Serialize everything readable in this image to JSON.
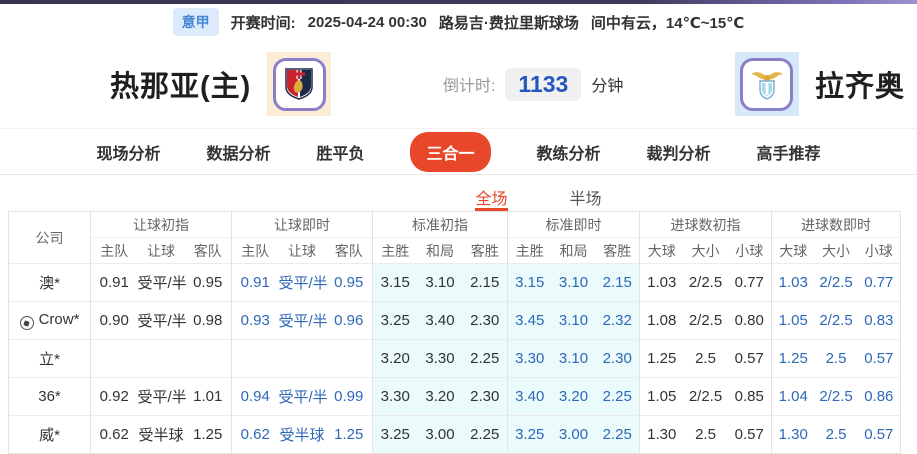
{
  "topbar": {
    "league": "意甲",
    "kickoff_label": "开赛时间:",
    "kickoff_time": "2025-04-24 00:30",
    "venue": "路易吉·费拉里斯球场",
    "weather": "间中有云，14℃~15℃"
  },
  "match": {
    "home_team": "热那亚(主)",
    "away_team": "拉齐奥",
    "home_logo": "genoa-crest",
    "away_logo": "lazio-crest",
    "countdown_label": "倒计时:",
    "countdown_value": "1133",
    "countdown_unit": "分钟"
  },
  "nav_tabs": [
    {
      "label": "现场分析",
      "active": false
    },
    {
      "label": "数据分析",
      "active": false
    },
    {
      "label": "胜平负",
      "active": false
    },
    {
      "label": "三合一",
      "active": true
    },
    {
      "label": "教练分析",
      "active": false
    },
    {
      "label": "裁判分析",
      "active": false
    },
    {
      "label": "高手推荐",
      "active": false
    }
  ],
  "period_tabs": [
    {
      "label": "全场",
      "active": true
    },
    {
      "label": "半场",
      "active": false
    }
  ],
  "colors": {
    "accent": "#e8472a",
    "live_blue": "#2e68b8",
    "standard_tint": "#ebfafa",
    "top_bar_purple": "#413a5e"
  },
  "odds_table": {
    "company_header": "公司",
    "groups": [
      {
        "label": "让球初指",
        "cols": [
          "主队",
          "让球",
          "客队"
        ],
        "tint": false,
        "live": false
      },
      {
        "label": "让球即时",
        "cols": [
          "主队",
          "让球",
          "客队"
        ],
        "tint": false,
        "live": true
      },
      {
        "label": "标准初指",
        "cols": [
          "主胜",
          "和局",
          "客胜"
        ],
        "tint": true,
        "live": false
      },
      {
        "label": "标准即时",
        "cols": [
          "主胜",
          "和局",
          "客胜"
        ],
        "tint": true,
        "live": true
      },
      {
        "label": "进球数初指",
        "cols": [
          "大球",
          "大小",
          "小球"
        ],
        "tint": false,
        "live": false
      },
      {
        "label": "进球数即时",
        "cols": [
          "大球",
          "大小",
          "小球"
        ],
        "tint": false,
        "live": true
      }
    ],
    "rows": [
      {
        "company": "澳*",
        "icon": false,
        "values": [
          [
            "0.91",
            "受平/半",
            "0.95"
          ],
          [
            "0.91",
            "受平/半",
            "0.95"
          ],
          [
            "3.15",
            "3.10",
            "2.15"
          ],
          [
            "3.15",
            "3.10",
            "2.15"
          ],
          [
            "1.03",
            "2/2.5",
            "0.77"
          ],
          [
            "1.03",
            "2/2.5",
            "0.77"
          ]
        ]
      },
      {
        "company": "Crow*",
        "icon": true,
        "values": [
          [
            "0.90",
            "受平/半",
            "0.98"
          ],
          [
            "0.93",
            "受平/半",
            "0.96"
          ],
          [
            "3.25",
            "3.40",
            "2.30"
          ],
          [
            "3.45",
            "3.10",
            "2.32"
          ],
          [
            "1.08",
            "2/2.5",
            "0.80"
          ],
          [
            "1.05",
            "2/2.5",
            "0.83"
          ]
        ]
      },
      {
        "company": "立*",
        "icon": false,
        "values": [
          [
            "",
            "",
            ""
          ],
          [
            "",
            "",
            ""
          ],
          [
            "3.20",
            "3.30",
            "2.25"
          ],
          [
            "3.30",
            "3.10",
            "2.30"
          ],
          [
            "1.25",
            "2.5",
            "0.57"
          ],
          [
            "1.25",
            "2.5",
            "0.57"
          ]
        ]
      },
      {
        "company": "36*",
        "icon": false,
        "values": [
          [
            "0.92",
            "受平/半",
            "1.01"
          ],
          [
            "0.94",
            "受平/半",
            "0.99"
          ],
          [
            "3.30",
            "3.20",
            "2.30"
          ],
          [
            "3.40",
            "3.20",
            "2.25"
          ],
          [
            "1.05",
            "2/2.5",
            "0.85"
          ],
          [
            "1.04",
            "2/2.5",
            "0.86"
          ]
        ]
      },
      {
        "company": "威*",
        "icon": false,
        "values": [
          [
            "0.62",
            "受半球",
            "1.25"
          ],
          [
            "0.62",
            "受半球",
            "1.25"
          ],
          [
            "3.25",
            "3.00",
            "2.25"
          ],
          [
            "3.25",
            "3.00",
            "2.25"
          ],
          [
            "1.30",
            "2.5",
            "0.57"
          ],
          [
            "1.30",
            "2.5",
            "0.57"
          ]
        ]
      }
    ]
  }
}
